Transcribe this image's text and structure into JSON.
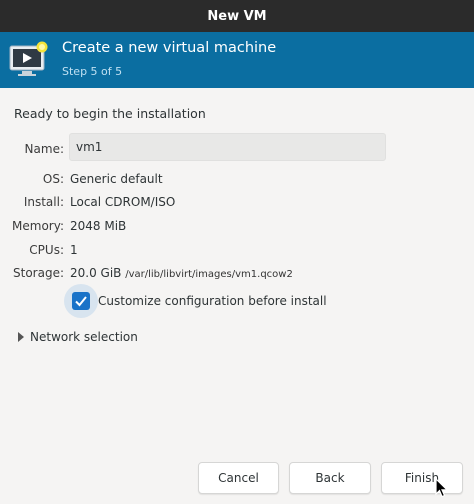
{
  "window": {
    "title": "New VM"
  },
  "banner": {
    "title": "Create a new virtual machine",
    "step": "Step 5 of 5"
  },
  "main": {
    "ready_text": "Ready to begin the installation",
    "name": {
      "label": "Name:",
      "value": "vm1"
    },
    "os": {
      "label": "OS:",
      "value": "Generic default"
    },
    "install": {
      "label": "Install:",
      "value": "Local CDROM/ISO"
    },
    "memory": {
      "label": "Memory:",
      "value": "2048 MiB"
    },
    "cpus": {
      "label": "CPUs:",
      "value": "1"
    },
    "storage": {
      "label": "Storage:",
      "value": "20.0 GiB",
      "path": "/var/lib/libvirt/images/vm1.qcow2"
    },
    "customize": {
      "label": "Customize configuration before install",
      "checked": true
    },
    "network": {
      "label": "Network selection",
      "expanded": false
    }
  },
  "buttons": {
    "cancel": "Cancel",
    "back": "Back",
    "finish": "Finish"
  },
  "colors": {
    "banner": "#0b6ea1",
    "titlebar": "#2b2b2b",
    "checkbox": "#1a73c8"
  },
  "icons": {
    "banner": "monitor-play-icon",
    "expander": "triangle-right-icon",
    "cursor": "mouse-pointer-icon"
  }
}
